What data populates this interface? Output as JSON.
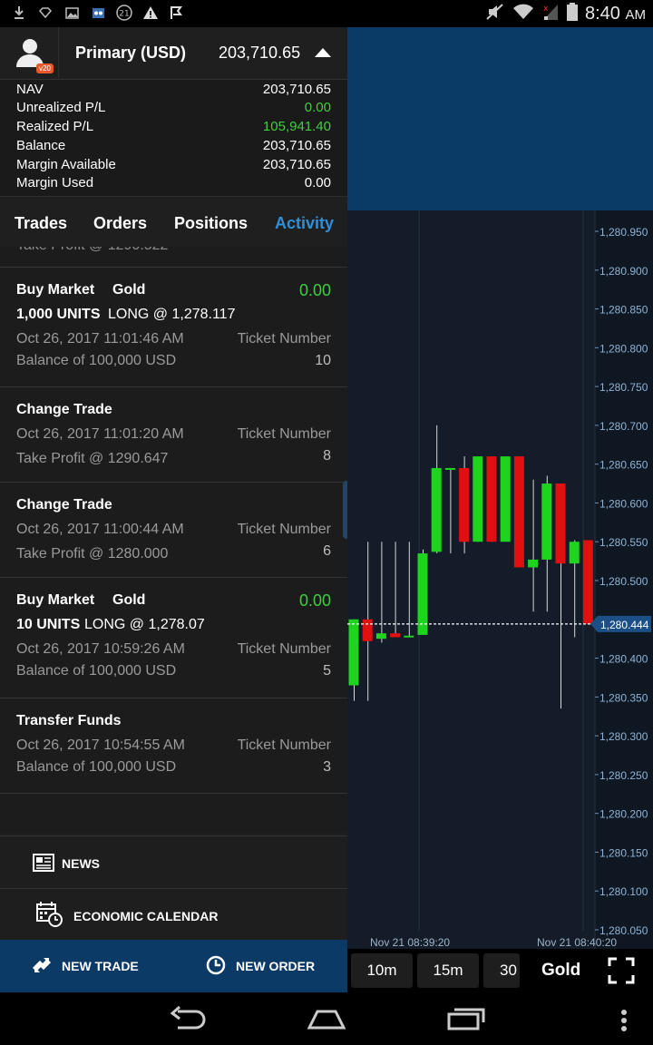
{
  "status_bar": {
    "time": "8:40",
    "ampm": "AM",
    "left_icons": [
      "download-icon",
      "diamond-icon",
      "image-icon",
      "oo-icon",
      "badge-21-icon",
      "warning-icon",
      "flag-icon"
    ],
    "right_icons": [
      "mute-icon",
      "wifi-icon",
      "signal-icon",
      "battery-icon"
    ]
  },
  "account": {
    "avatar_badge": "v20",
    "name": "Primary (USD)",
    "value": "203,710.65"
  },
  "summary": [
    {
      "label": "NAV",
      "value": "203,710.65"
    },
    {
      "label": "Unrealized P/L",
      "value": "0.00"
    },
    {
      "label": "Realized P/L",
      "value": "105,941.40"
    },
    {
      "label": "Balance",
      "value": "203,710.65"
    },
    {
      "label": "Margin Available",
      "value": "203,710.65"
    },
    {
      "label": "Margin Used",
      "value": "0.00"
    }
  ],
  "tabs": [
    "Trades",
    "Orders",
    "Positions",
    "Activity"
  ],
  "active_tab": "Activity",
  "activity": {
    "partial_row": "Take Profit @ 1290.522",
    "items": [
      {
        "title": "Buy Market",
        "instrument": "Gold",
        "value": "0.00",
        "units": "1,000 UNITS",
        "position": "LONG @ 1,278.117",
        "date": "Oct 26, 2017 11:01:46 AM",
        "ticket_label": "Ticket Number",
        "detail": "Balance of 100,000 USD",
        "ticket": "10"
      },
      {
        "title": "Change Trade",
        "date": "Oct 26, 2017 11:01:20 AM",
        "ticket_label": "Ticket Number",
        "detail": "Take Profit @ 1290.647",
        "ticket": "8"
      },
      {
        "title": "Change Trade",
        "date": "Oct 26, 2017 11:00:44 AM",
        "ticket_label": "Ticket Number",
        "detail": "Take Profit @ 1280.000",
        "ticket": "6"
      },
      {
        "title": "Buy Market",
        "instrument": "Gold",
        "value": "0.00",
        "units": "10 UNITS",
        "position": "LONG @ 1,278.07",
        "date": "Oct 26, 2017 10:59:26 AM",
        "ticket_label": "Ticket Number",
        "detail": "Balance of 100,000 USD",
        "ticket": "5"
      },
      {
        "title": "Transfer Funds",
        "date": "Oct 26, 2017 10:54:55 AM",
        "ticket_label": "Ticket Number",
        "detail": "Balance of 100,000 USD",
        "ticket": "3"
      }
    ]
  },
  "menu": {
    "news": "NEWS",
    "calendar": "ECONOMIC CALENDAR"
  },
  "actions": {
    "new_trade": "NEW TRADE",
    "new_order": "NEW ORDER"
  },
  "chart": {
    "y_ticks": [
      "1,280.950",
      "1,280.900",
      "1,280.850",
      "1,280.800",
      "1,280.750",
      "1,280.700",
      "1,280.650",
      "1,280.600",
      "1,280.550",
      "1,280.500",
      "1,280.450",
      "1,280.400",
      "1,280.350",
      "1,280.300",
      "1,280.250",
      "1,280.200",
      "1,280.150",
      "1,280.100",
      "1,280.050"
    ],
    "current_price": "1,280.444",
    "x_ticks": [
      "Nov 21 08:39:20",
      "Nov 21 08:40:20"
    ],
    "timeframes": [
      "10m",
      "15m",
      "30"
    ],
    "instrument": "Gold",
    "up_color": "#1ed41e",
    "down_color": "#e01010"
  },
  "chart_data": {
    "type": "candlestick",
    "ylim": [
      1280.045,
      1280.965
    ],
    "candles": [
      {
        "o": 1280.365,
        "h": 1280.45,
        "l": 1280.345,
        "c": 1280.45
      },
      {
        "o": 1280.45,
        "h": 1280.55,
        "l": 1280.345,
        "c": 1280.422
      },
      {
        "o": 1280.425,
        "h": 1280.55,
        "l": 1280.42,
        "c": 1280.432
      },
      {
        "o": 1280.432,
        "h": 1280.55,
        "l": 1280.43,
        "c": 1280.427
      },
      {
        "o": 1280.428,
        "h": 1280.55,
        "l": 1280.428,
        "c": 1280.429
      },
      {
        "o": 1280.43,
        "h": 1280.54,
        "l": 1280.43,
        "c": 1280.535
      },
      {
        "o": 1280.537,
        "h": 1280.7,
        "l": 1280.535,
        "c": 1280.645
      },
      {
        "o": 1280.645,
        "h": 1280.645,
        "l": 1280.535,
        "c": 1280.645
      },
      {
        "o": 1280.645,
        "h": 1280.66,
        "l": 1280.535,
        "c": 1280.55
      },
      {
        "o": 1280.55,
        "h": 1280.66,
        "l": 1280.55,
        "c": 1280.66
      },
      {
        "o": 1280.66,
        "h": 1280.66,
        "l": 1280.55,
        "c": 1280.55
      },
      {
        "o": 1280.55,
        "h": 1280.66,
        "l": 1280.55,
        "c": 1280.66
      },
      {
        "o": 1280.66,
        "h": 1280.66,
        "l": 1280.517,
        "c": 1280.517
      },
      {
        "o": 1280.517,
        "h": 1280.63,
        "l": 1280.46,
        "c": 1280.527
      },
      {
        "o": 1280.527,
        "h": 1280.635,
        "l": 1280.46,
        "c": 1280.625
      },
      {
        "o": 1280.625,
        "h": 1280.625,
        "l": 1280.335,
        "c": 1280.522
      },
      {
        "o": 1280.522,
        "h": 1280.552,
        "l": 1280.427,
        "c": 1280.55
      },
      {
        "o": 1280.552,
        "h": 1280.552,
        "l": 1280.444,
        "c": 1280.444
      }
    ]
  }
}
